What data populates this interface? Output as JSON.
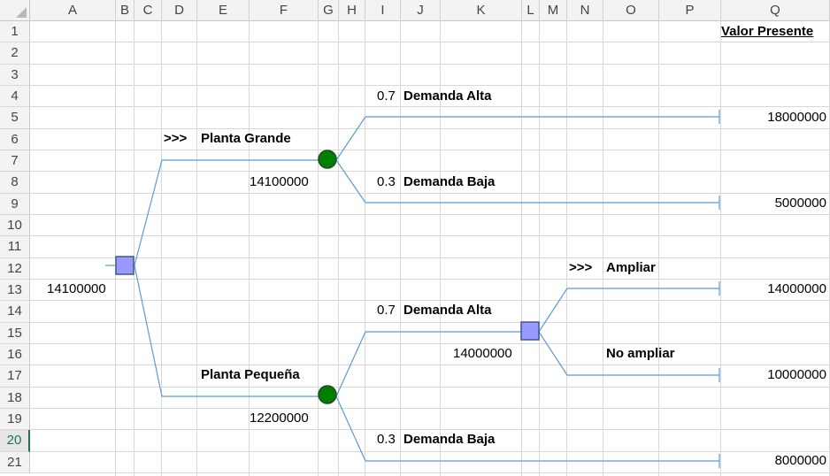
{
  "columns": [
    "A",
    "B",
    "C",
    "D",
    "E",
    "F",
    "G",
    "H",
    "I",
    "J",
    "K",
    "L",
    "M",
    "N",
    "O",
    "P",
    "Q"
  ],
  "rows": [
    "1",
    "2",
    "3",
    "4",
    "5",
    "6",
    "7",
    "8",
    "9",
    "10",
    "11",
    "12",
    "13",
    "14",
    "15",
    "16",
    "17",
    "18",
    "19",
    "20",
    "21"
  ],
  "header_title": "Valor Presente",
  "decisions": {
    "root_value": "14100000",
    "large_plant": "Planta Grande",
    "small_plant": "Planta Pequeña",
    "expand": "Ampliar",
    "no_expand": "No ampliar",
    "arrow": ">>>"
  },
  "chance_nodes": {
    "large_value": "14100000",
    "small_value": "12200000"
  },
  "second_decision_value": "14000000",
  "branches": {
    "high_prob": "0.7",
    "high_label": "Demanda Alta",
    "low_prob": "0.3",
    "low_label": "Demanda Baja"
  },
  "payoffs": {
    "large_high": "18000000",
    "large_low": "5000000",
    "expand": "14000000",
    "no_expand": "10000000",
    "small_low": "8000000"
  },
  "selected_row": "20",
  "colors": {
    "line": "#5b9bd5",
    "decision_fill": "#9999ff",
    "decision_border": "#3a5a8c",
    "chance_fill": "#008000",
    "chance_border": "#1e4d1e",
    "grid": "#d8d8d8",
    "header_bg": "#f3f3f3"
  }
}
